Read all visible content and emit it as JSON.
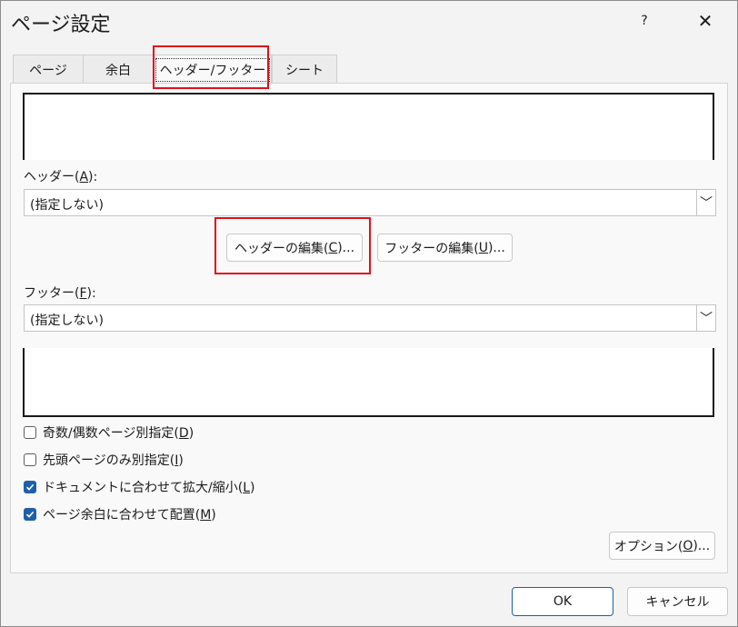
{
  "dialog": {
    "title": "ページ設定",
    "help_label": "?",
    "close_label": "✕"
  },
  "tabs": [
    {
      "label": "ページ"
    },
    {
      "label": "余白"
    },
    {
      "label": "ヘッダー/フッター"
    },
    {
      "label": "シート"
    }
  ],
  "header": {
    "label_prefix": "ヘッダー(",
    "label_accel": "A",
    "label_suffix": "):",
    "value": "(指定しない)"
  },
  "edit_header_button": {
    "prefix": "ヘッダーの編集(",
    "accel": "C",
    "suffix": ")..."
  },
  "edit_footer_button": {
    "prefix": "フッターの編集(",
    "accel": "U",
    "suffix": ")..."
  },
  "footer": {
    "label_prefix": "フッター(",
    "label_accel": "F",
    "label_suffix": "):",
    "value": "(指定しない)"
  },
  "dropdown_arrow": "﹀",
  "checkboxes": [
    {
      "prefix": "奇数/偶数ページ別指定(",
      "accel": "D",
      "suffix": ")",
      "checked": false
    },
    {
      "prefix": "先頭ページのみ別指定(",
      "accel": "I",
      "suffix": ")",
      "checked": false
    },
    {
      "prefix": "ドキュメントに合わせて拡大/縮小(",
      "accel": "L",
      "suffix": ")",
      "checked": true
    },
    {
      "prefix": "ページ余白に合わせて配置(",
      "accel": "M",
      "suffix": ")",
      "checked": true
    }
  ],
  "options_button": {
    "prefix": "オプション(",
    "accel": "O",
    "suffix": ")..."
  },
  "ok_label": "OK",
  "cancel_label": "キャンセル",
  "checkmark": "✓",
  "colors": {
    "accent": "#1f5fa8",
    "highlight": "#e0101a"
  }
}
